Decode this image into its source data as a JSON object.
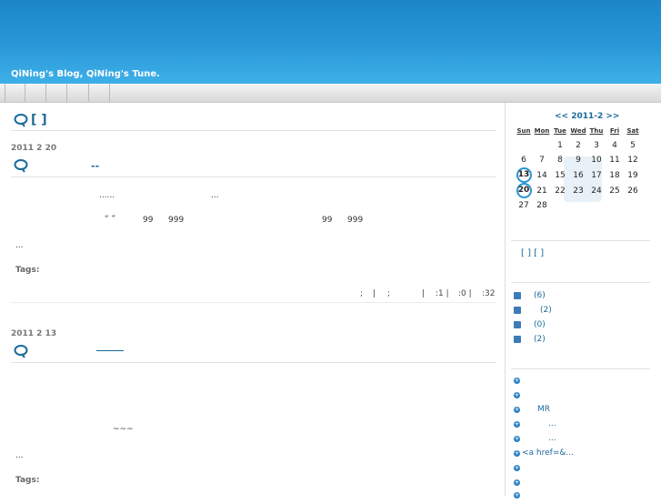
{
  "header": {
    "blog_title": "QiNing's Blog, QiNing's Tune."
  },
  "page": {
    "heading": "[ ]"
  },
  "posts": [
    {
      "date": "2011 2 20",
      "title": "--",
      "lines": [
        "......",
        "...",
        "“ ”",
        "99",
        "999",
        "99",
        "999",
        "..."
      ],
      "tags_label": "Tags:",
      "meta": [
        ";",
        "|",
        ";",
        "|",
        ":1 |",
        ":0 |",
        ":32"
      ]
    },
    {
      "date": "2011 2 13",
      "lines": [
        "~~~",
        "..."
      ],
      "tags_label": "Tags:"
    }
  ],
  "calendar": {
    "nav": "<< 2011-2 >>",
    "headers": [
      "Sun",
      "Mon",
      "Tue",
      "Wed",
      "Thu",
      "Fri",
      "Sat"
    ],
    "weeks": [
      [
        "",
        "",
        "1",
        "2",
        "3",
        "4",
        "5"
      ],
      [
        "6",
        "7",
        "8",
        "9",
        "10",
        "11",
        "12"
      ],
      [
        "13",
        "14",
        "15",
        "16",
        "17",
        "18",
        "19"
      ],
      [
        "20",
        "21",
        "22",
        "23",
        "24",
        "25",
        "26"
      ],
      [
        "27",
        "28",
        "",
        "",
        "",
        "",
        ""
      ]
    ]
  },
  "sidebar": {
    "links_line": "[ ] [ ]",
    "rss_counts": [
      "(6)",
      "(2)",
      "(0)",
      "(2)"
    ],
    "list_items": [
      "",
      "",
      "MR",
      "...",
      "...",
      "<a href=&...",
      "",
      "",
      ""
    ]
  }
}
